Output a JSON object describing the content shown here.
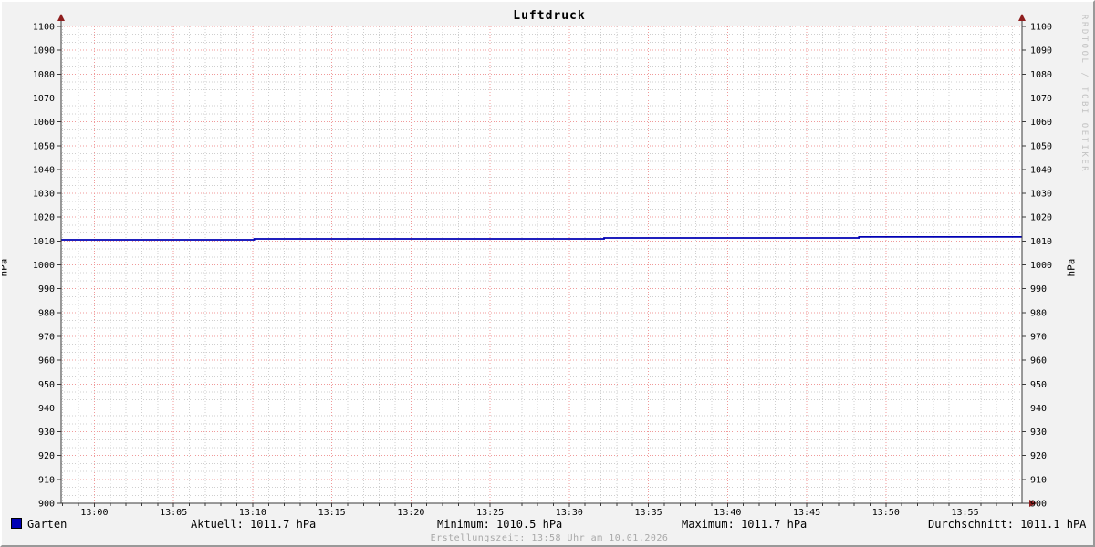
{
  "title": "Luftdruck",
  "watermark": "RRDTOOL / TOBI OETIKER",
  "footer": "Erstellungszeit: 13:58 Uhr am 10.01.2026",
  "y_axis": {
    "unit_label": "hPa"
  },
  "legend": {
    "series_label": "Garten",
    "series_color": "#0000b4",
    "aktuell": "Aktuell: 1011.7 hPa",
    "minimum": "Minimum: 1010.5 hPa",
    "maximum": "Maximum: 1011.7 hPa",
    "durchschnitt": "Durchschnitt: 1011.1 hPA"
  },
  "colors": {
    "background": "#f2f2f2",
    "canvas": "#ffffff",
    "grid_major": "#f09a9a",
    "grid_minor": "#cfcfcf",
    "axis": "#3a3a3a",
    "arrow": "#8f1f1f",
    "line": "#0000b4",
    "text": "#000000",
    "watermark": "#c2c2c2"
  },
  "chart_data": {
    "type": "line",
    "title": "Luftdruck",
    "ylabel": "hPa",
    "ylim": [
      900,
      1100
    ],
    "y_tick_step": 10,
    "y_ticks": [
      900,
      910,
      920,
      930,
      940,
      950,
      960,
      970,
      980,
      990,
      1000,
      1010,
      1020,
      1030,
      1040,
      1050,
      1060,
      1070,
      1080,
      1090,
      1100
    ],
    "x_ticks": [
      {
        "label": "13:00",
        "minute": 0
      },
      {
        "label": "13:05",
        "minute": 5
      },
      {
        "label": "13:10",
        "minute": 10
      },
      {
        "label": "13:15",
        "minute": 15
      },
      {
        "label": "13:20",
        "minute": 20
      },
      {
        "label": "13:25",
        "minute": 25
      },
      {
        "label": "13:30",
        "minute": 30
      },
      {
        "label": "13:35",
        "minute": 35
      },
      {
        "label": "13:40",
        "minute": 40
      },
      {
        "label": "13:45",
        "minute": 45
      },
      {
        "label": "13:50",
        "minute": 50
      },
      {
        "label": "13:55",
        "minute": 55
      }
    ],
    "x_range_minutes": [
      -2.1,
      58.6
    ],
    "minor_x_step_minutes": 1,
    "minor_y_divisions": 3,
    "grid": true,
    "legend_position": "bottom",
    "series": [
      {
        "name": "Garten",
        "color": "#0000b4",
        "points": [
          {
            "t": -2.1,
            "v": 1010.5
          },
          {
            "t": 10.1,
            "v": 1010.5
          },
          {
            "t": 10.1,
            "v": 1010.9
          },
          {
            "t": 32.2,
            "v": 1010.9
          },
          {
            "t": 32.2,
            "v": 1011.3
          },
          {
            "t": 48.3,
            "v": 1011.3
          },
          {
            "t": 48.3,
            "v": 1011.7
          },
          {
            "t": 58.6,
            "v": 1011.7
          }
        ]
      }
    ],
    "stats": {
      "aktuell_hPa": 1011.7,
      "minimum_hPa": 1010.5,
      "maximum_hPa": 1011.7,
      "durchschnitt_hPa": 1011.1
    }
  }
}
